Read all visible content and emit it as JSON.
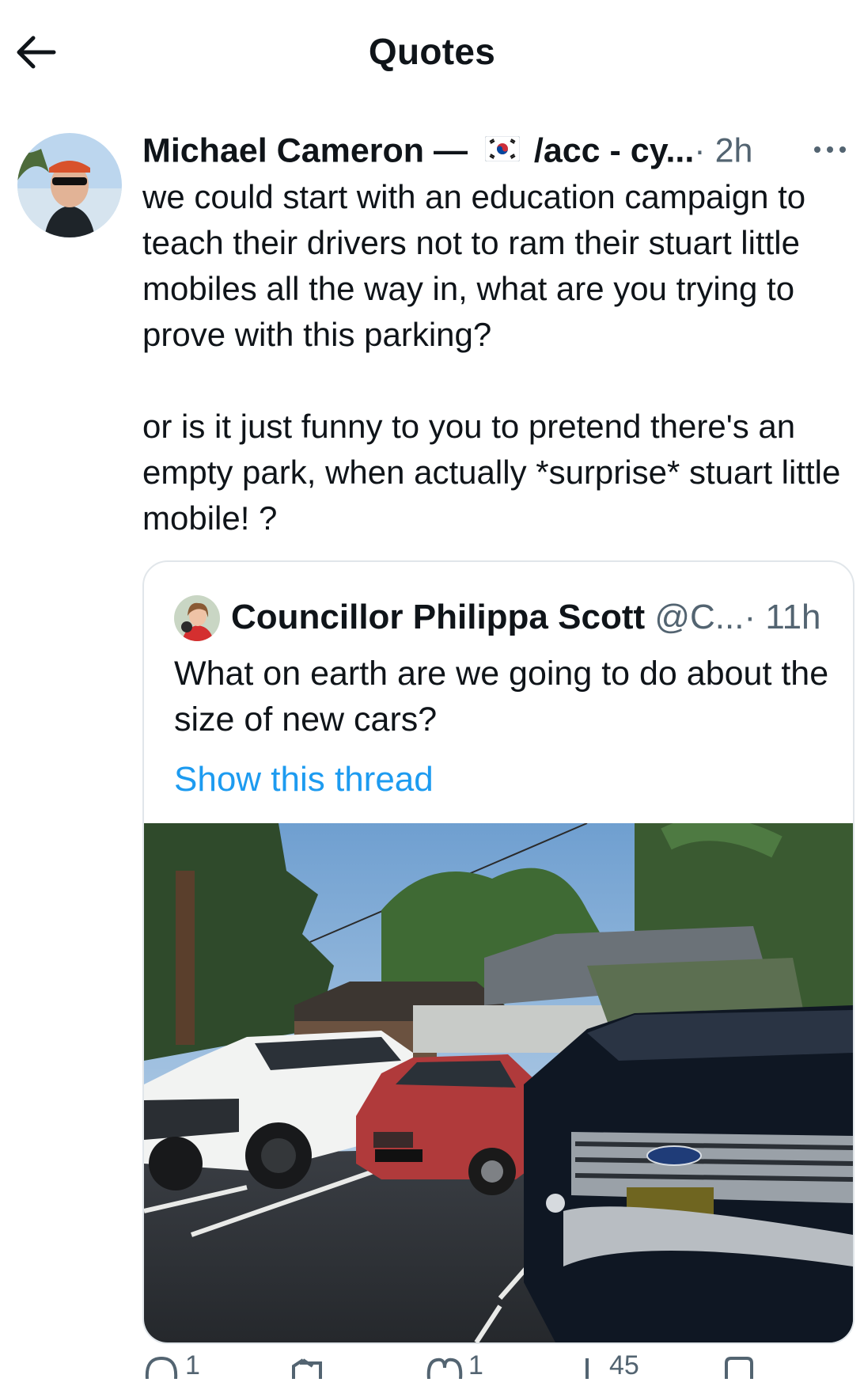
{
  "header": {
    "title": "Quotes"
  },
  "tweet": {
    "author_name": "Michael Cameron —",
    "author_flag_icon": "south-korea-flag-icon",
    "author_suffix": "/acc - cy...",
    "time": "· 2h",
    "paragraphs": [
      "we could start with an education campaign to teach their drivers not to ram their stuart little mobiles all the way in, what are you trying to prove with this parking?",
      "or is it just funny to you to pretend there's an empty park, when actually *surprise* stuart little mobile! ?"
    ]
  },
  "quoted": {
    "author_name": "Councillor Philippa Scott",
    "handle": "@C...",
    "time": "· 11h",
    "text": "What on earth are we going to do about the size of new cars?",
    "show_thread": "Show this thread",
    "photo_subject": "parking-lot-cars-photo"
  },
  "actions": {
    "reply_count": "1",
    "like_count": "1",
    "views_count": "45"
  },
  "colors": {
    "link": "#1d9bf0",
    "muted": "#536471",
    "border": "#e1e6ea",
    "text": "#0f1419"
  }
}
